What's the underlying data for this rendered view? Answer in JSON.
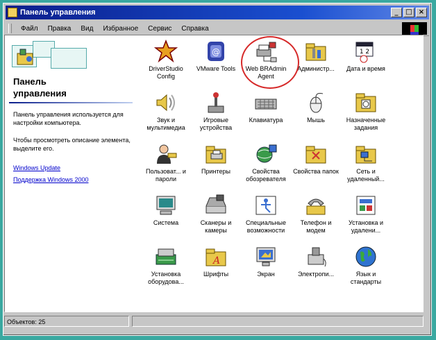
{
  "window": {
    "title": "Панель управления"
  },
  "menu": [
    "Файл",
    "Правка",
    "Вид",
    "Избранное",
    "Сервис",
    "Справка"
  ],
  "left_panel": {
    "title_line1": "Панель",
    "title_line2": "управления",
    "description": "Панель управления используется для настройки компьютера.",
    "hint": "Чтобы просмотреть описание элемента, выделите его.",
    "links": [
      "Windows Update",
      "Поддержка Windows 2000"
    ]
  },
  "items": [
    {
      "label": "DriverStudio Config",
      "icon": "driverstudio-icon"
    },
    {
      "label": "VMware Tools",
      "icon": "vmware-icon"
    },
    {
      "label": "Web BRAdmin Agent",
      "icon": "printer-network-icon"
    },
    {
      "label": "Администр...",
      "icon": "admin-tools-icon"
    },
    {
      "label": "Дата и время",
      "icon": "calendar-clock-icon"
    },
    {
      "label": "Звук и мультимедиа",
      "icon": "speaker-icon"
    },
    {
      "label": "Игровые устройства",
      "icon": "joystick-icon"
    },
    {
      "label": "Клавиатура",
      "icon": "keyboard-icon"
    },
    {
      "label": "Мышь",
      "icon": "mouse-icon"
    },
    {
      "label": "Назначенные задания",
      "icon": "scheduled-tasks-icon"
    },
    {
      "label": "Пользоват... и пароли",
      "icon": "users-icon"
    },
    {
      "label": "Принтеры",
      "icon": "printer-folder-icon"
    },
    {
      "label": "Свойства обозревателя",
      "icon": "internet-options-icon"
    },
    {
      "label": "Свойства папок",
      "icon": "folder-options-icon"
    },
    {
      "label": "Сеть и удаленный...",
      "icon": "network-icon"
    },
    {
      "label": "Система",
      "icon": "system-icon"
    },
    {
      "label": "Сканеры и камеры",
      "icon": "scanner-icon"
    },
    {
      "label": "Специальные возможности",
      "icon": "accessibility-icon"
    },
    {
      "label": "Телефон и модем",
      "icon": "phone-modem-icon"
    },
    {
      "label": "Установка и удалени...",
      "icon": "add-remove-icon"
    },
    {
      "label": "Установка оборудова...",
      "icon": "hardware-icon"
    },
    {
      "label": "Шрифты",
      "icon": "fonts-icon"
    },
    {
      "label": "Экран",
      "icon": "display-icon"
    },
    {
      "label": "Электропи...",
      "icon": "power-icon"
    },
    {
      "label": "Язык и стандарты",
      "icon": "globe-icon"
    }
  ],
  "status": {
    "left": "Объектов: 25"
  },
  "colors": {
    "title_start": "#0a1e8c",
    "title_end": "#5e86e6",
    "highlight": "#d62a2a",
    "link": "#0000cc"
  }
}
